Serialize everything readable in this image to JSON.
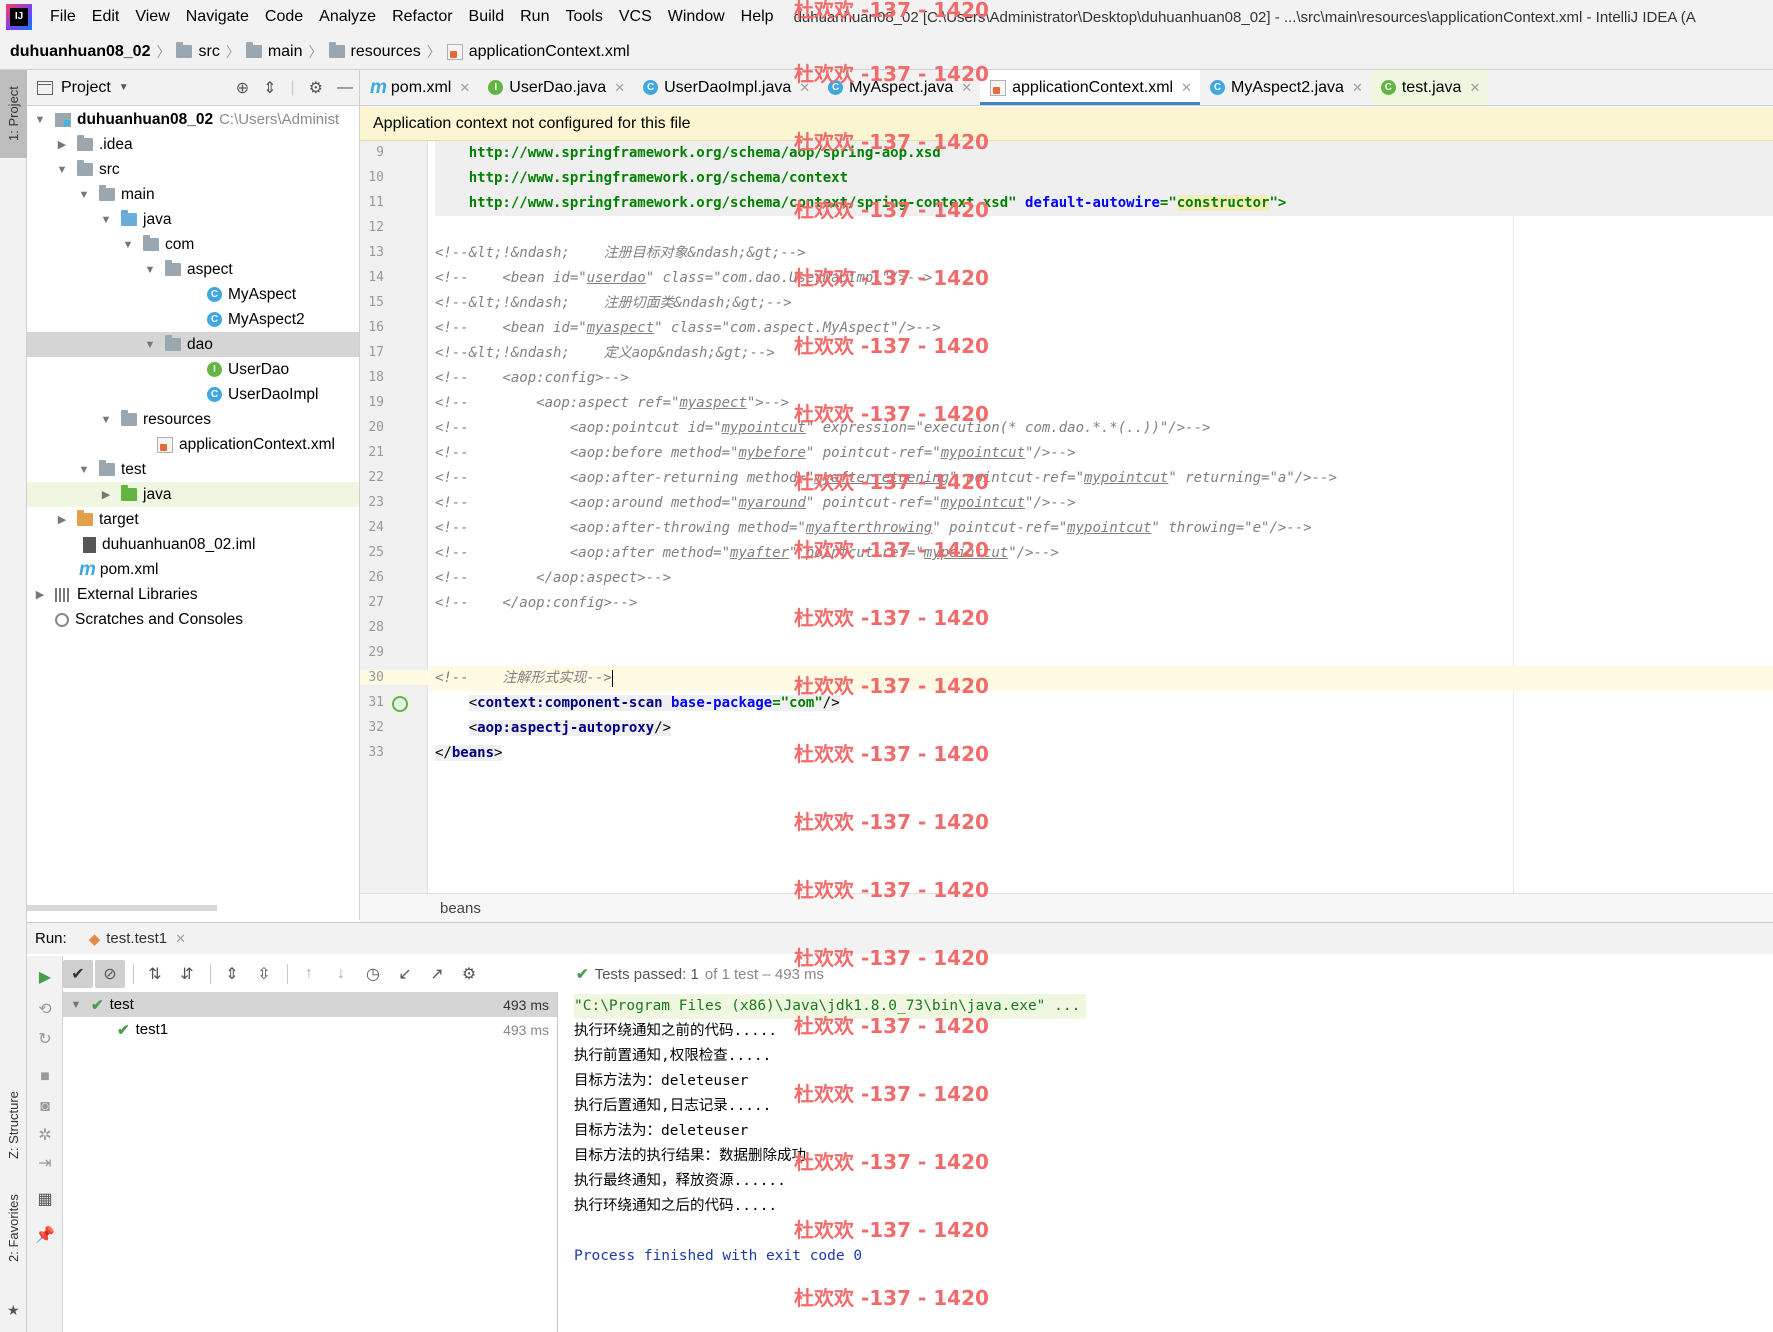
{
  "menubar": {
    "items": [
      "File",
      "Edit",
      "View",
      "Navigate",
      "Code",
      "Analyze",
      "Refactor",
      "Build",
      "Run",
      "Tools",
      "VCS",
      "Window",
      "Help"
    ],
    "title": "duhuanhuan08_02 [C:\\Users\\Administrator\\Desktop\\duhuanhuan08_02] - ...\\src\\main\\resources\\applicationContext.xml - IntelliJ IDEA (A"
  },
  "breadcrumb": [
    "duhuanhuan08_02",
    "src",
    "main",
    "resources",
    "applicationContext.xml"
  ],
  "left_stripe": {
    "project": "1: Project",
    "structure": "Z: Structure",
    "favorites": "2: Favorites"
  },
  "project": {
    "title": "Project",
    "tree": [
      {
        "label": "duhuanhuan08_02",
        "extra": "C:\\Users\\Administ",
        "icon": "module-icon"
      },
      {
        "label": ".idea",
        "icon": "folder-icon"
      },
      {
        "label": "src",
        "icon": "folder-icon"
      },
      {
        "label": "main",
        "icon": "folder-icon"
      },
      {
        "label": "java",
        "icon": "source-folder-icon"
      },
      {
        "label": "com",
        "icon": "package-icon"
      },
      {
        "label": "aspect",
        "icon": "package-icon"
      },
      {
        "label": "MyAspect",
        "icon": "class-icon"
      },
      {
        "label": "MyAspect2",
        "icon": "class-icon"
      },
      {
        "label": "dao",
        "icon": "package-icon"
      },
      {
        "label": "UserDao",
        "icon": "interface-icon"
      },
      {
        "label": "UserDaoImpl",
        "icon": "class-icon"
      },
      {
        "label": "resources",
        "icon": "resources-folder-icon"
      },
      {
        "label": "applicationContext.xml",
        "icon": "xml-file-icon"
      },
      {
        "label": "test",
        "icon": "folder-icon"
      },
      {
        "label": "java",
        "icon": "test-folder-icon"
      },
      {
        "label": "target",
        "icon": "excluded-folder-icon"
      },
      {
        "label": "duhuanhuan08_02.iml",
        "icon": "iml-file-icon"
      },
      {
        "label": "pom.xml",
        "icon": "maven-icon"
      },
      {
        "label": "External Libraries",
        "icon": "library-icon"
      },
      {
        "label": "Scratches and Consoles",
        "icon": "scratch-icon"
      }
    ]
  },
  "tabs": [
    {
      "label": "pom.xml"
    },
    {
      "label": "UserDao.java"
    },
    {
      "label": "UserDaoImpl.java"
    },
    {
      "label": "MyAspect.java"
    },
    {
      "label": "applicationContext.xml"
    },
    {
      "label": "MyAspect2.java"
    },
    {
      "label": "test.java"
    }
  ],
  "banner": "Application context not configured for this file",
  "editor": {
    "line_numbers": [
      "9",
      "10",
      "11",
      "12",
      "13",
      "14",
      "15",
      "16",
      "17",
      "18",
      "19",
      "20",
      "21",
      "22",
      "23",
      "24",
      "25",
      "26",
      "27",
      "28",
      "29",
      "30",
      "31",
      "32",
      "33"
    ],
    "l9": "http://www.springframework.org/schema/aop/spring-aop.xsd",
    "l10": "http://www.springframework.org/schema/context",
    "l11_url": "http://www.springframework.org/schema/context/spring-context.xsd\"",
    "l11_attr": "default-autowire",
    "l11_eq": "=\"",
    "l11_val": "constructor",
    "l11_end": "\">",
    "l13": "<!--&lt;!&ndash;    注册目标对象&ndash;&gt;-->",
    "l14a": "<!--    <bean id=\"",
    "l14b": "userdao",
    "l14c": "\" class=\"com.dao.UserDaoImpl\"/>-->",
    "l15": "<!--&lt;!&ndash;    注册切面类&ndash;&gt;-->",
    "l16a": "<!--    <bean id=\"",
    "l16b": "myaspect",
    "l16c": "\" class=\"com.aspect.MyAspect\"/>-->",
    "l17": "<!--&lt;!&ndash;    定义aop&ndash;&gt;-->",
    "l18": "<!--    <aop:config>-->",
    "l19a": "<!--        <aop:aspect ref=\"",
    "l19b": "myaspect",
    "l19c": "\">-->",
    "l20a": "<!--            <aop:pointcut id=\"",
    "l20b": "mypointcut",
    "l20c": "\" expression=\"execution(* com.dao.*.*(..))\"/>-->",
    "l21a": "<!--            <aop:before method=\"",
    "l21b": "mybefore",
    "l21c": "\" pointcut-ref=\"",
    "l21d": "mypointcut",
    "l21e": "\"/>-->",
    "l22a": "<!--            <aop:after-returning method=\"",
    "l22b": "myafterretuening",
    "l22c": "\" pointcut-ref=\"",
    "l22d": "mypointcut",
    "l22e": "\" returning=\"a\"/>-->",
    "l23a": "<!--            <aop:around method=\"",
    "l23b": "myaround",
    "l23c": "\" pointcut-ref=\"",
    "l23d": "mypointcut",
    "l23e": "\"/>-->",
    "l24a": "<!--            <aop:after-throwing method=\"",
    "l24b": "myafterthrowing",
    "l24c": "\" pointcut-ref=\"",
    "l24d": "mypointcut",
    "l24e": "\" throwing=\"e\"/>-->",
    "l25a": "<!--            <aop:after method=\"",
    "l25b": "myafter",
    "l25c": "\" pointcut-ref=\"",
    "l25d": "mypointcut",
    "l25e": "\"/>-->",
    "l26": "<!--        </aop:aspect>-->",
    "l27": "<!--    </aop:config>-->",
    "l30": "<!--    注解形式实现-->",
    "l31_open": "<",
    "l31_tag": "context:component-scan",
    "l31_attr": "base-package",
    "l31_val": "=\"com\"",
    "l31_close": "/>",
    "l32_open": "<",
    "l32_tag": "aop:aspectj-autoproxy",
    "l32_close": "/>",
    "l33_open": "</",
    "l33_tag": "beans",
    "l33_close": ">"
  },
  "editor_status": "beans",
  "run": {
    "label": "Run:",
    "tab": "test.test1",
    "passed_label": "Tests passed:",
    "passed_count": "1",
    "passed_rest": "of 1 test – 493 ms",
    "tree": [
      {
        "label": "test",
        "time": "493 ms"
      },
      {
        "label": "test1",
        "time": "493 ms"
      }
    ],
    "console": [
      "\"C:\\Program Files (x86)\\Java\\jdk1.8.0_73\\bin\\java.exe\" ...",
      "执行环绕通知之前的代码.....",
      "执行前置通知,权限检查.....",
      "目标方法为：deleteuser",
      "执行后置通知,日志记录.....",
      "目标方法为：deleteuser",
      "目标方法的执行结果：数据删除成功",
      "执行最终通知，释放资源......",
      "执行环绕通知之后的代码.....",
      "",
      "Process finished with exit code 0"
    ]
  },
  "watermark": "杜欢欢 -137 - 1420",
  "colors": {
    "accent": "#4083c9",
    "banner": "#fbf6d1",
    "pass": "#499c54",
    "watermark": "#f26b6b"
  }
}
